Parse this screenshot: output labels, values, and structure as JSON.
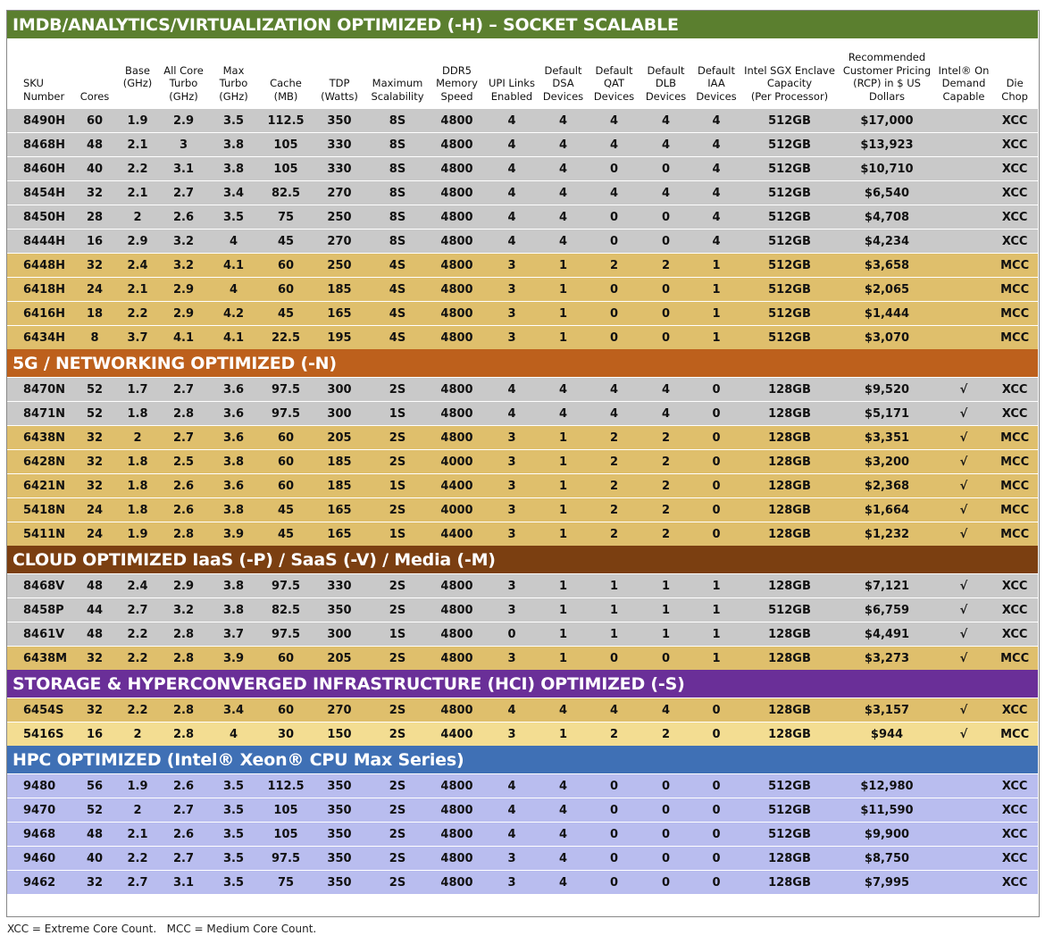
{
  "colors": {
    "gray": "#c9c9c9",
    "gold": "#dfbf6c",
    "lightgold": "#f3dd92",
    "lavender": "#b9bdef"
  },
  "headers": [
    "SKU\nNumber",
    "Cores",
    "Base\n(GHz)\n ",
    "All Core\nTurbo\n(GHz)",
    "Max\nTurbo\n(GHz)",
    "Cache\n(MB)",
    "TDP\n(Watts)",
    "Maximum\nScalability",
    "DDR5\nMemory\nSpeed",
    "UPI Links\nEnabled",
    "Default\nDSA\nDevices",
    "Default\nQAT\nDevices",
    "Default\nDLB\nDevices",
    "Default\nIAA\nDevices",
    "Intel SGX Enclave\nCapacity\n(Per Processor)",
    "Recommended\nCustomer Pricing\n(RCP) in $ US\nDollars",
    "Intel® On\nDemand\nCapable",
    "Die\nChop"
  ],
  "sections": [
    {
      "title": "IMDB/ANALYTICS/VIRTUALIZATION OPTIMIZED (-H) – SOCKET SCALABLE",
      "color": "#5b7f2f",
      "show_header": true,
      "rows": [
        {
          "shade": "gray",
          "cells": [
            "8490H",
            "60",
            "1.9",
            "2.9",
            "3.5",
            "112.5",
            "350",
            "8S",
            "4800",
            "4",
            "4",
            "4",
            "4",
            "4",
            "512GB",
            "$17,000",
            "",
            "XCC"
          ]
        },
        {
          "shade": "gray",
          "cells": [
            "8468H",
            "48",
            "2.1",
            "3",
            "3.8",
            "105",
            "330",
            "8S",
            "4800",
            "4",
            "4",
            "4",
            "4",
            "4",
            "512GB",
            "$13,923",
            "",
            "XCC"
          ]
        },
        {
          "shade": "gray",
          "cells": [
            "8460H",
            "40",
            "2.2",
            "3.1",
            "3.8",
            "105",
            "330",
            "8S",
            "4800",
            "4",
            "4",
            "0",
            "0",
            "4",
            "512GB",
            "$10,710",
            "",
            "XCC"
          ]
        },
        {
          "shade": "gray",
          "cells": [
            "8454H",
            "32",
            "2.1",
            "2.7",
            "3.4",
            "82.5",
            "270",
            "8S",
            "4800",
            "4",
            "4",
            "4",
            "4",
            "4",
            "512GB",
            "$6,540",
            "",
            "XCC"
          ]
        },
        {
          "shade": "gray",
          "cells": [
            "8450H",
            "28",
            "2",
            "2.6",
            "3.5",
            "75",
            "250",
            "8S",
            "4800",
            "4",
            "4",
            "0",
            "0",
            "4",
            "512GB",
            "$4,708",
            "",
            "XCC"
          ]
        },
        {
          "shade": "gray",
          "cells": [
            "8444H",
            "16",
            "2.9",
            "3.2",
            "4",
            "45",
            "270",
            "8S",
            "4800",
            "4",
            "4",
            "0",
            "0",
            "4",
            "512GB",
            "$4,234",
            "",
            "XCC"
          ]
        },
        {
          "shade": "gold",
          "cells": [
            "6448H",
            "32",
            "2.4",
            "3.2",
            "4.1",
            "60",
            "250",
            "4S",
            "4800",
            "3",
            "1",
            "2",
            "2",
            "1",
            "512GB",
            "$3,658",
            "",
            "MCC"
          ]
        },
        {
          "shade": "gold",
          "cells": [
            "6418H",
            "24",
            "2.1",
            "2.9",
            "4",
            "60",
            "185",
            "4S",
            "4800",
            "3",
            "1",
            "0",
            "0",
            "1",
            "512GB",
            "$2,065",
            "",
            "MCC"
          ]
        },
        {
          "shade": "gold",
          "cells": [
            "6416H",
            "18",
            "2.2",
            "2.9",
            "4.2",
            "45",
            "165",
            "4S",
            "4800",
            "3",
            "1",
            "0",
            "0",
            "1",
            "512GB",
            "$1,444",
            "",
            "MCC"
          ]
        },
        {
          "shade": "gold",
          "cells": [
            "6434H",
            "8",
            "3.7",
            "4.1",
            "4.1",
            "22.5",
            "195",
            "4S",
            "4800",
            "3",
            "1",
            "0",
            "0",
            "1",
            "512GB",
            "$3,070",
            "",
            "MCC"
          ]
        }
      ]
    },
    {
      "title": "5G / NETWORKING OPTIMIZED (-N)",
      "color": "#bd601c",
      "rows": [
        {
          "shade": "gray",
          "cells": [
            "8470N",
            "52",
            "1.7",
            "2.7",
            "3.6",
            "97.5",
            "300",
            "2S",
            "4800",
            "4",
            "4",
            "4",
            "4",
            "0",
            "128GB",
            "$9,520",
            "√",
            "XCC"
          ]
        },
        {
          "shade": "gray",
          "cells": [
            "8471N",
            "52",
            "1.8",
            "2.8",
            "3.6",
            "97.5",
            "300",
            "1S",
            "4800",
            "4",
            "4",
            "4",
            "4",
            "0",
            "128GB",
            "$5,171",
            "√",
            "XCC"
          ]
        },
        {
          "shade": "gold",
          "cells": [
            "6438N",
            "32",
            "2",
            "2.7",
            "3.6",
            "60",
            "205",
            "2S",
            "4800",
            "3",
            "1",
            "2",
            "2",
            "0",
            "128GB",
            "$3,351",
            "√",
            "MCC"
          ]
        },
        {
          "shade": "gold",
          "cells": [
            "6428N",
            "32",
            "1.8",
            "2.5",
            "3.8",
            "60",
            "185",
            "2S",
            "4000",
            "3",
            "1",
            "2",
            "2",
            "0",
            "128GB",
            "$3,200",
            "√",
            "MCC"
          ]
        },
        {
          "shade": "gold",
          "cells": [
            "6421N",
            "32",
            "1.8",
            "2.6",
            "3.6",
            "60",
            "185",
            "1S",
            "4400",
            "3",
            "1",
            "2",
            "2",
            "0",
            "128GB",
            "$2,368",
            "√",
            "MCC"
          ]
        },
        {
          "shade": "gold",
          "cells": [
            "5418N",
            "24",
            "1.8",
            "2.6",
            "3.8",
            "45",
            "165",
            "2S",
            "4000",
            "3",
            "1",
            "2",
            "2",
            "0",
            "128GB",
            "$1,664",
            "√",
            "MCC"
          ]
        },
        {
          "shade": "gold",
          "cells": [
            "5411N",
            "24",
            "1.9",
            "2.8",
            "3.9",
            "45",
            "165",
            "1S",
            "4400",
            "3",
            "1",
            "2",
            "2",
            "0",
            "128GB",
            "$1,232",
            "√",
            "MCC"
          ]
        }
      ]
    },
    {
      "title": "CLOUD OPTIMIZED IaaS (-P) / SaaS (-V) / Media (-M)",
      "color": "#7b3f11",
      "rows": [
        {
          "shade": "gray",
          "cells": [
            "8468V",
            "48",
            "2.4",
            "2.9",
            "3.8",
            "97.5",
            "330",
            "2S",
            "4800",
            "3",
            "1",
            "1",
            "1",
            "1",
            "128GB",
            "$7,121",
            "√",
            "XCC"
          ]
        },
        {
          "shade": "gray",
          "cells": [
            "8458P",
            "44",
            "2.7",
            "3.2",
            "3.8",
            "82.5",
            "350",
            "2S",
            "4800",
            "3",
            "1",
            "1",
            "1",
            "1",
            "512GB",
            "$6,759",
            "√",
            "XCC"
          ]
        },
        {
          "shade": "gray",
          "cells": [
            "8461V",
            "48",
            "2.2",
            "2.8",
            "3.7",
            "97.5",
            "300",
            "1S",
            "4800",
            "0",
            "1",
            "1",
            "1",
            "1",
            "128GB",
            "$4,491",
            "√",
            "XCC"
          ]
        },
        {
          "shade": "gold",
          "cells": [
            "6438M",
            "32",
            "2.2",
            "2.8",
            "3.9",
            "60",
            "205",
            "2S",
            "4800",
            "3",
            "1",
            "0",
            "0",
            "1",
            "128GB",
            "$3,273",
            "√",
            "MCC"
          ]
        }
      ]
    },
    {
      "title": "STORAGE & HYPERCONVERGED INFRASTRUCTURE (HCI) OPTIMIZED (-S)",
      "color": "#6a2f98",
      "rows": [
        {
          "shade": "gold",
          "cells": [
            "6454S",
            "32",
            "2.2",
            "2.8",
            "3.4",
            "60",
            "270",
            "2S",
            "4800",
            "4",
            "4",
            "4",
            "4",
            "0",
            "128GB",
            "$3,157",
            "√",
            "XCC"
          ]
        },
        {
          "shade": "lightgold",
          "cells": [
            "5416S",
            "16",
            "2",
            "2.8",
            "4",
            "30",
            "150",
            "2S",
            "4400",
            "3",
            "1",
            "2",
            "2",
            "0",
            "128GB",
            "$944",
            "√",
            "MCC"
          ]
        }
      ]
    },
    {
      "title": "HPC OPTIMIZED (Intel® Xeon® CPU Max Series)",
      "color": "#3f70b5",
      "rows": [
        {
          "shade": "lavender",
          "cells": [
            "9480",
            "56",
            "1.9",
            "2.6",
            "3.5",
            "112.5",
            "350",
            "2S",
            "4800",
            "4",
            "4",
            "0",
            "0",
            "0",
            "512GB",
            "$12,980",
            "",
            "XCC"
          ]
        },
        {
          "shade": "lavender",
          "cells": [
            "9470",
            "52",
            "2",
            "2.7",
            "3.5",
            "105",
            "350",
            "2S",
            "4800",
            "4",
            "4",
            "0",
            "0",
            "0",
            "512GB",
            "$11,590",
            "",
            "XCC"
          ]
        },
        {
          "shade": "lavender",
          "cells": [
            "9468",
            "48",
            "2.1",
            "2.6",
            "3.5",
            "105",
            "350",
            "2S",
            "4800",
            "4",
            "4",
            "0",
            "0",
            "0",
            "512GB",
            "$9,900",
            "",
            "XCC"
          ]
        },
        {
          "shade": "lavender",
          "cells": [
            "9460",
            "40",
            "2.2",
            "2.7",
            "3.5",
            "97.5",
            "350",
            "2S",
            "4800",
            "3",
            "4",
            "0",
            "0",
            "0",
            "128GB",
            "$8,750",
            "",
            "XCC"
          ]
        },
        {
          "shade": "lavender",
          "cells": [
            "9462",
            "32",
            "2.7",
            "3.1",
            "3.5",
            "75",
            "350",
            "2S",
            "4800",
            "3",
            "4",
            "0",
            "0",
            "0",
            "128GB",
            "$7,995",
            "",
            "XCC"
          ]
        }
      ]
    }
  ],
  "footnote": "XCC = Extreme Core Count.   MCC = Medium Core Count."
}
